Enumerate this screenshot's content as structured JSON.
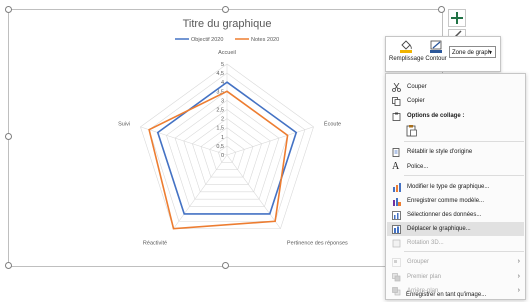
{
  "chart_data": {
    "type": "radar",
    "title": "Titre du graphique",
    "categories": [
      "Accueil",
      "Écoute",
      "Pertinence des réponses",
      "Réactivité",
      "Suivi"
    ],
    "r_ticks": [
      "5",
      "4,5",
      "4",
      "3,5",
      "3",
      "2,5",
      "2",
      "1,5",
      "1",
      "0,5",
      "0"
    ],
    "r_range": [
      0,
      5
    ],
    "series": [
      {
        "name": "Objectif 2020",
        "color": "#4472c4",
        "values": [
          4,
          4,
          4,
          4,
          4
        ]
      },
      {
        "name": "Notes 2020",
        "color": "#ed7d31",
        "values": [
          3.5,
          3.5,
          4.5,
          5,
          4.5
        ]
      }
    ],
    "legend": "top",
    "grid": true
  },
  "mini_toolbar": {
    "fill_label": "Remplissage",
    "outline_label": "Contour",
    "element_select": "Zone de graph"
  },
  "context_menu": {
    "items": [
      {
        "label": "Couper",
        "icon": "scissors-icon",
        "enabled": true
      },
      {
        "label": "Copier",
        "icon": "copy-icon",
        "enabled": true
      },
      {
        "label": "Options de collage :",
        "icon": "paste-icon",
        "enabled": true,
        "heading": true
      },
      {
        "label": "Rétablir le style d'origine",
        "icon": "reset-style-icon",
        "enabled": true
      },
      {
        "label": "Police...",
        "icon": "font-icon",
        "enabled": true
      },
      {
        "label": "Modifier le type de graphique...",
        "icon": "chart-type-icon",
        "enabled": true
      },
      {
        "label": "Enregistrer comme modèle...",
        "icon": "save-template-icon",
        "enabled": true
      },
      {
        "label": "Sélectionner des données...",
        "icon": "select-data-icon",
        "enabled": true
      },
      {
        "label": "Déplacer le graphique...",
        "icon": "move-chart-icon",
        "enabled": true,
        "highlighted": true
      },
      {
        "label": "Rotation 3D...",
        "icon": "rotation-3d-icon",
        "enabled": false
      },
      {
        "label": "Grouper",
        "icon": "group-icon",
        "enabled": false,
        "submenu": true
      },
      {
        "label": "Premier plan",
        "icon": "bring-front-icon",
        "enabled": false,
        "submenu": true
      },
      {
        "label": "Arrière-plan",
        "icon": "send-back-icon",
        "enabled": false,
        "submenu": true
      },
      {
        "label": "Enregistrer en tant qu'image...",
        "icon": "",
        "enabled": true
      }
    ]
  },
  "colors": {
    "accent_blue": "#4472c4",
    "accent_orange": "#ed7d31",
    "plus_green": "#217346"
  }
}
